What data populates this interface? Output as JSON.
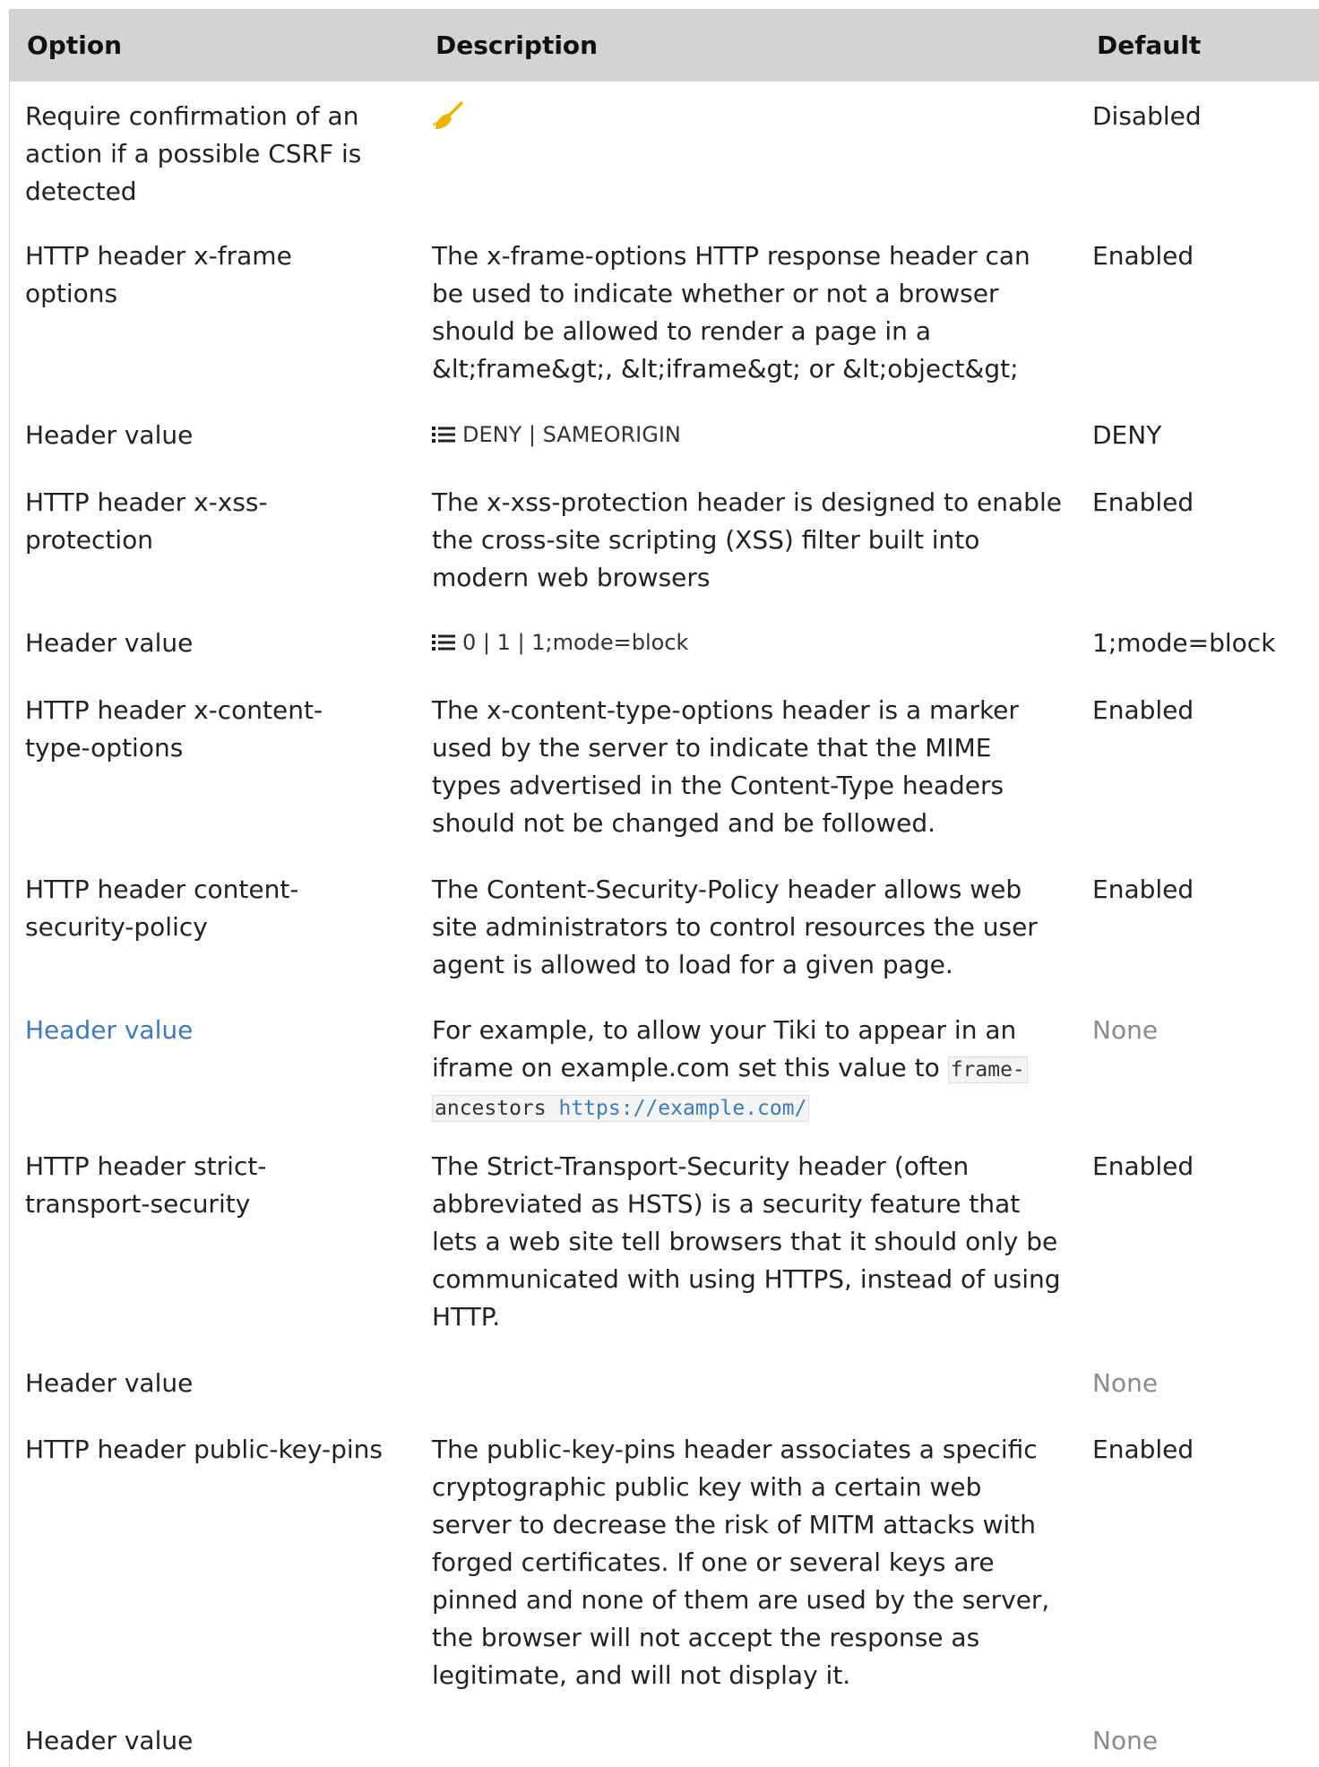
{
  "headers": {
    "option": "Option",
    "description": "Description",
    "default": "Default"
  },
  "rows": [
    {
      "option": "Require confirmation of an action if a possible CSRF is detected",
      "description_icon": "broom-icon",
      "default": "Disabled"
    },
    {
      "option": "HTTP header x-frame options",
      "description": "The x-frame-options HTTP response header can be used to indicate whether or not a browser should be allowed to render a page in a &lt;frame&gt;, &lt;iframe&gt; or &lt;object&gt;",
      "default": "Enabled"
    },
    {
      "option": "Header value",
      "description_icon": "list-icon",
      "description": "DENY | SAMEORIGIN",
      "default": "DENY"
    },
    {
      "option": "HTTP header x-xss-protection",
      "description": "The x-xss-protection header is designed to enable the cross-site scripting (XSS) filter built into modern web browsers",
      "default": "Enabled"
    },
    {
      "option": "Header value",
      "description_icon": "list-icon",
      "description": "0 | 1 | 1;mode=block",
      "default": "1;mode=block"
    },
    {
      "option": "HTTP header x-content-type-options",
      "description": "The x-content-type-options header is a marker used by the server to indicate that the MIME types advertised in the Content-Type headers should not be changed and be followed.",
      "default": "Enabled"
    },
    {
      "option": "HTTP header content-security-policy",
      "description": "The Content-Security-Policy header allows web site administrators to control resources the user agent is allowed to load for a given page.",
      "default": "Enabled"
    },
    {
      "option": "Header value",
      "description": "For example, to allow your Tiki to appear in an iframe on example.com set this value to",
      "code_prefix": "frame-ancestors ",
      "code_url": "https://example.com/",
      "default": "None"
    },
    {
      "option": "HTTP header strict-transport-security",
      "description": "The Strict-Transport-Security header (often abbreviated as HSTS) is a security feature that lets a web site tell browsers that it should only be communicated with using HTTPS, instead of using HTTP.",
      "default": "Enabled"
    },
    {
      "option": "Header value",
      "description": "",
      "default": "None"
    },
    {
      "option": "HTTP header public-key-pins",
      "description": "The public-key-pins header associates a specific cryptographic public key with a certain web server to decrease the risk of MITM attacks with forged certificates. If one or several keys are pinned and none of them are used by the server, the browser will not accept the response as legitimate, and will not display it.",
      "default": "Enabled"
    },
    {
      "option": "Header value",
      "description": "",
      "default": "None"
    }
  ],
  "colors": {
    "header_bg": "#d3d3d3",
    "link": "#3b7bbf",
    "muted": "#8a8a8a",
    "broom_icon": "#f0b400"
  }
}
